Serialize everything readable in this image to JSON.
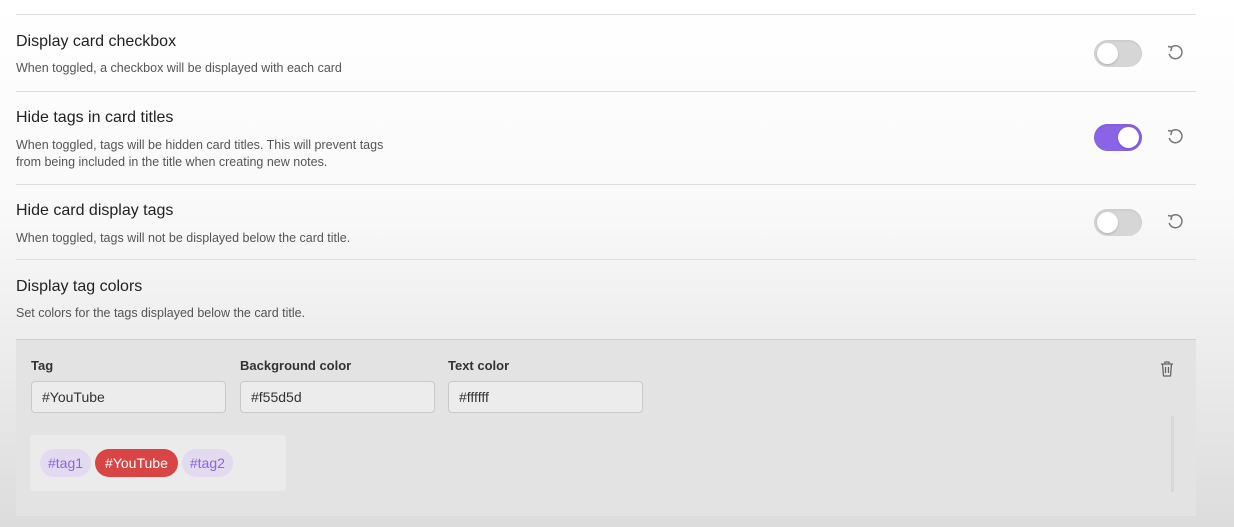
{
  "colors": {
    "accent": "#8b63e6",
    "toggle_off": "#d6d6d6"
  },
  "settings": [
    {
      "title": "Display card checkbox",
      "description_lines": [
        "When toggled, a checkbox will be displayed with each card"
      ],
      "toggle_on": false,
      "reset_icon": "reset-icon"
    },
    {
      "title": "Hide tags in card titles",
      "description_lines": [
        "When toggled, tags will be hidden card titles. This will prevent tags",
        "from being included in the title when creating new notes."
      ],
      "toggle_on": true,
      "reset_icon": "reset-icon"
    },
    {
      "title": "Hide card display tags",
      "description_lines": [
        "When toggled, tags will not be displayed below the card title."
      ],
      "toggle_on": false,
      "reset_icon": "reset-icon"
    }
  ],
  "tag_colors": {
    "title": "Display tag colors",
    "description": "Set colors for the tags displayed below the card title.",
    "columns": {
      "tag": "Tag",
      "background": "Background color",
      "text": "Text color"
    },
    "entry": {
      "tag": "#YouTube",
      "background": "#f55d5d",
      "text": "#ffffff"
    },
    "delete_icon": "trash-icon",
    "preview_tags": [
      {
        "label": "#tag1",
        "colored": false
      },
      {
        "label": "#YouTube",
        "colored": true,
        "background": "#d94444",
        "text": "#ffffff"
      },
      {
        "label": "#tag2",
        "colored": false
      }
    ]
  }
}
